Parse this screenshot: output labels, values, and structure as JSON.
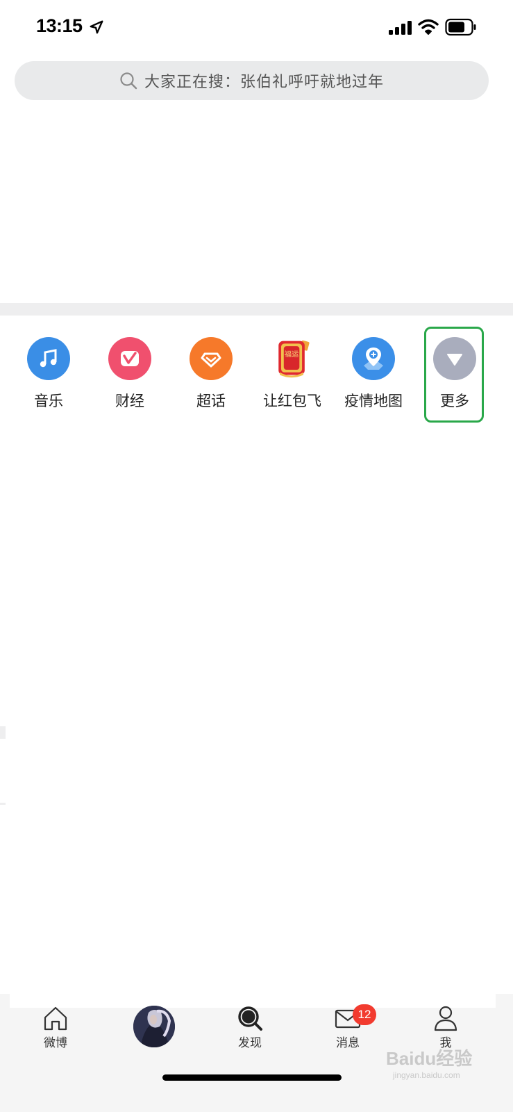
{
  "status_bar": {
    "time": "13:15"
  },
  "search": {
    "placeholder": "大家正在搜：张伯礼呼吁就地过年"
  },
  "shortcuts": [
    {
      "label": "音乐",
      "icon": "music-icon",
      "color": "#3a8ee6"
    },
    {
      "label": "财经",
      "icon": "finance-icon",
      "color": "#f0506e"
    },
    {
      "label": "超话",
      "icon": "super-topic-icon",
      "color": "#f6792a"
    },
    {
      "label": "让红包飞",
      "icon": "red-packet-icon",
      "badge_text": "福运",
      "color": "#d8262b"
    },
    {
      "label": "疫情地图",
      "icon": "epidemic-map-icon",
      "color": "#3b8fe8"
    },
    {
      "label": "更多",
      "icon": "more-down-icon",
      "color": "#a9adbd"
    }
  ],
  "tabbar": {
    "tabs": [
      {
        "label": "微博",
        "icon": "home-icon"
      },
      {
        "label": "",
        "icon": "avatar"
      },
      {
        "label": "发现",
        "icon": "discover-icon"
      },
      {
        "label": "消息",
        "icon": "message-icon",
        "badge": "12"
      },
      {
        "label": "我",
        "icon": "profile-icon"
      }
    ]
  },
  "watermark": {
    "main": "Baidu经验",
    "sub": "jingyan.baidu.com"
  }
}
